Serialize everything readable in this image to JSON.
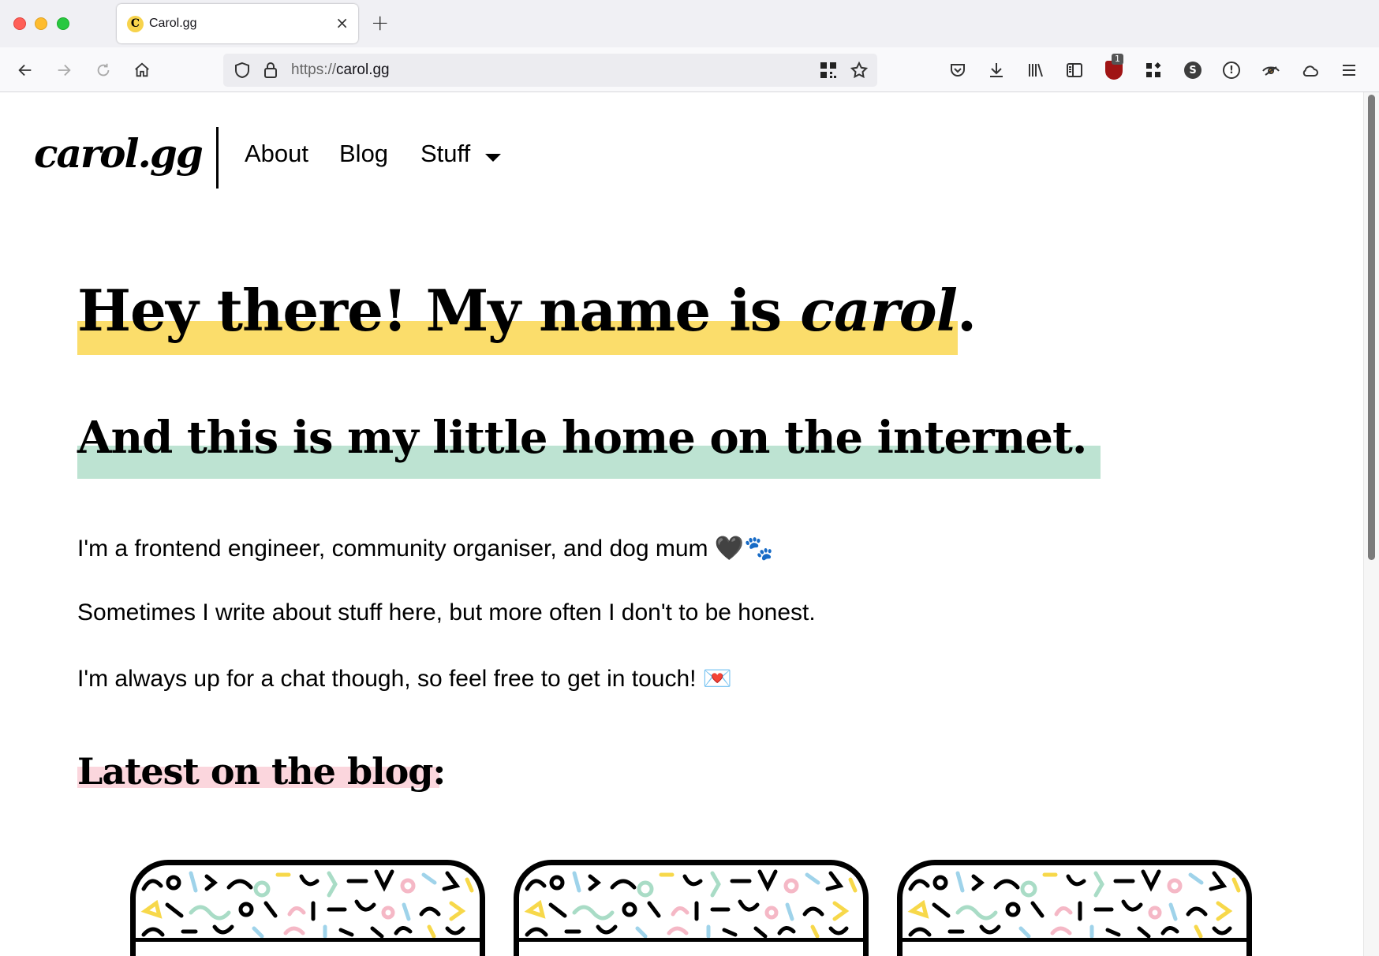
{
  "browser": {
    "tab_title": "Carol.gg",
    "tab_favicon": "C",
    "tab_close": "×",
    "new_tab": "+",
    "url_scheme": "https://",
    "url_host": "carol.gg",
    "ublock_count": "1",
    "ext_s_label": "S",
    "ext_pw_label": "!",
    "icons": [
      "back-arrow-icon",
      "forward-arrow-icon",
      "reload-icon",
      "home-icon",
      "shield-icon",
      "lock-icon",
      "qr-code-icon",
      "bookmark-star-icon",
      "pocket-icon",
      "download-icon",
      "library-icon",
      "sidebar-icon",
      "ublock-icon",
      "extension-grid-icon",
      "extension-s-icon",
      "password-icon",
      "eye-extension-icon",
      "cloud-icon",
      "hamburger-menu-icon"
    ]
  },
  "site": {
    "logo": "carol.gg",
    "nav": {
      "about": "About",
      "blog": "Blog",
      "stuff": "Stuff"
    }
  },
  "hero": {
    "line1_prefix": "Hey there! My name is ",
    "line1_name": "carol",
    "line1_suffix": ".",
    "line2": "And this is my little home on the internet."
  },
  "intro": {
    "p1": "I'm a frontend engineer, community organiser, and dog mum 🖤🐾",
    "p2": "Sometimes I write about stuff here, but more often I don't to be honest.",
    "p3": "I'm always up for a chat though, so feel free to get in touch! 💌"
  },
  "blog": {
    "heading": "Latest on the blog:"
  },
  "colors": {
    "highlight_yellow": "#fbdd6b",
    "highlight_green": "#bde3d2",
    "highlight_pink": "#fbd6dd",
    "pattern_blue": "#9fd3ea",
    "pattern_yellow": "#f7d84a",
    "pattern_green": "#a9dcc6",
    "pattern_pink": "#f5b8c6"
  }
}
